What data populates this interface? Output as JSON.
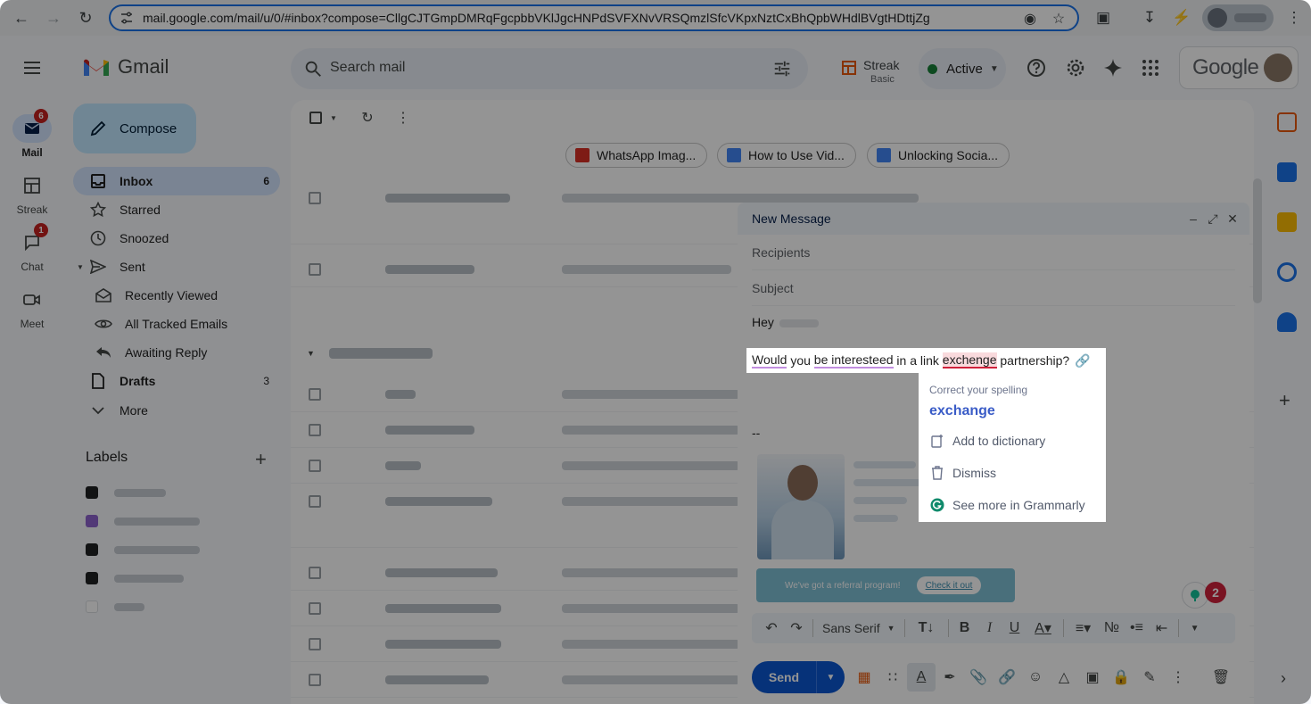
{
  "browser": {
    "url": "mail.google.com/mail/u/0/#inbox?compose=CllgCJTGmpDMRqFgcpbbVKlJgcHNPdSVFXNvVRSQmzlSfcVKpxNztCxBhQpbWHdlBVgtHDttjZg"
  },
  "header": {
    "app_name": "Gmail",
    "search_placeholder": "Search mail",
    "streak_name": "Streak",
    "streak_tier": "Basic",
    "status": "Active",
    "google_word": "Google"
  },
  "rail": [
    {
      "label": "Mail",
      "badge": "6"
    },
    {
      "label": "Streak"
    },
    {
      "label": "Chat",
      "badge": "1"
    },
    {
      "label": "Meet"
    }
  ],
  "compose_label": "Compose",
  "folders": [
    {
      "label": "Inbox",
      "count": "6"
    },
    {
      "label": "Starred"
    },
    {
      "label": "Snoozed"
    },
    {
      "label": "Sent"
    },
    {
      "label": "Recently Viewed"
    },
    {
      "label": "All Tracked Emails"
    },
    {
      "label": "Awaiting Reply"
    },
    {
      "label": "Drafts",
      "count": "3"
    },
    {
      "label": "More"
    }
  ],
  "labels_heading": "Labels",
  "chips": [
    "WhatsApp Imag...",
    "How to Use Vid...",
    "Unlocking Socia..."
  ],
  "compose": {
    "title": "New Message",
    "recipients_placeholder": "Recipients",
    "subject_placeholder": "Subject",
    "greeting": "Hey",
    "line_parts": [
      "Would",
      " you ",
      "be interesteed",
      " in a link ",
      "exchenge",
      " partnership?"
    ],
    "signature_dash": "--",
    "referral_text": "We've got a referral program!",
    "referral_cta": "Check it out",
    "grammarly_count": "2",
    "font_name": "Sans Serif",
    "send_label": "Send"
  },
  "grammarly_popup": {
    "hint": "Correct your spelling",
    "suggestion": "exchange",
    "add_dictionary": "Add to dictionary",
    "dismiss": "Dismiss",
    "see_more": "See more in Grammarly"
  },
  "colors": {
    "accent": "#0b57d0",
    "error_underline": "#d0213b",
    "grammarly_green": "#15c39a"
  }
}
